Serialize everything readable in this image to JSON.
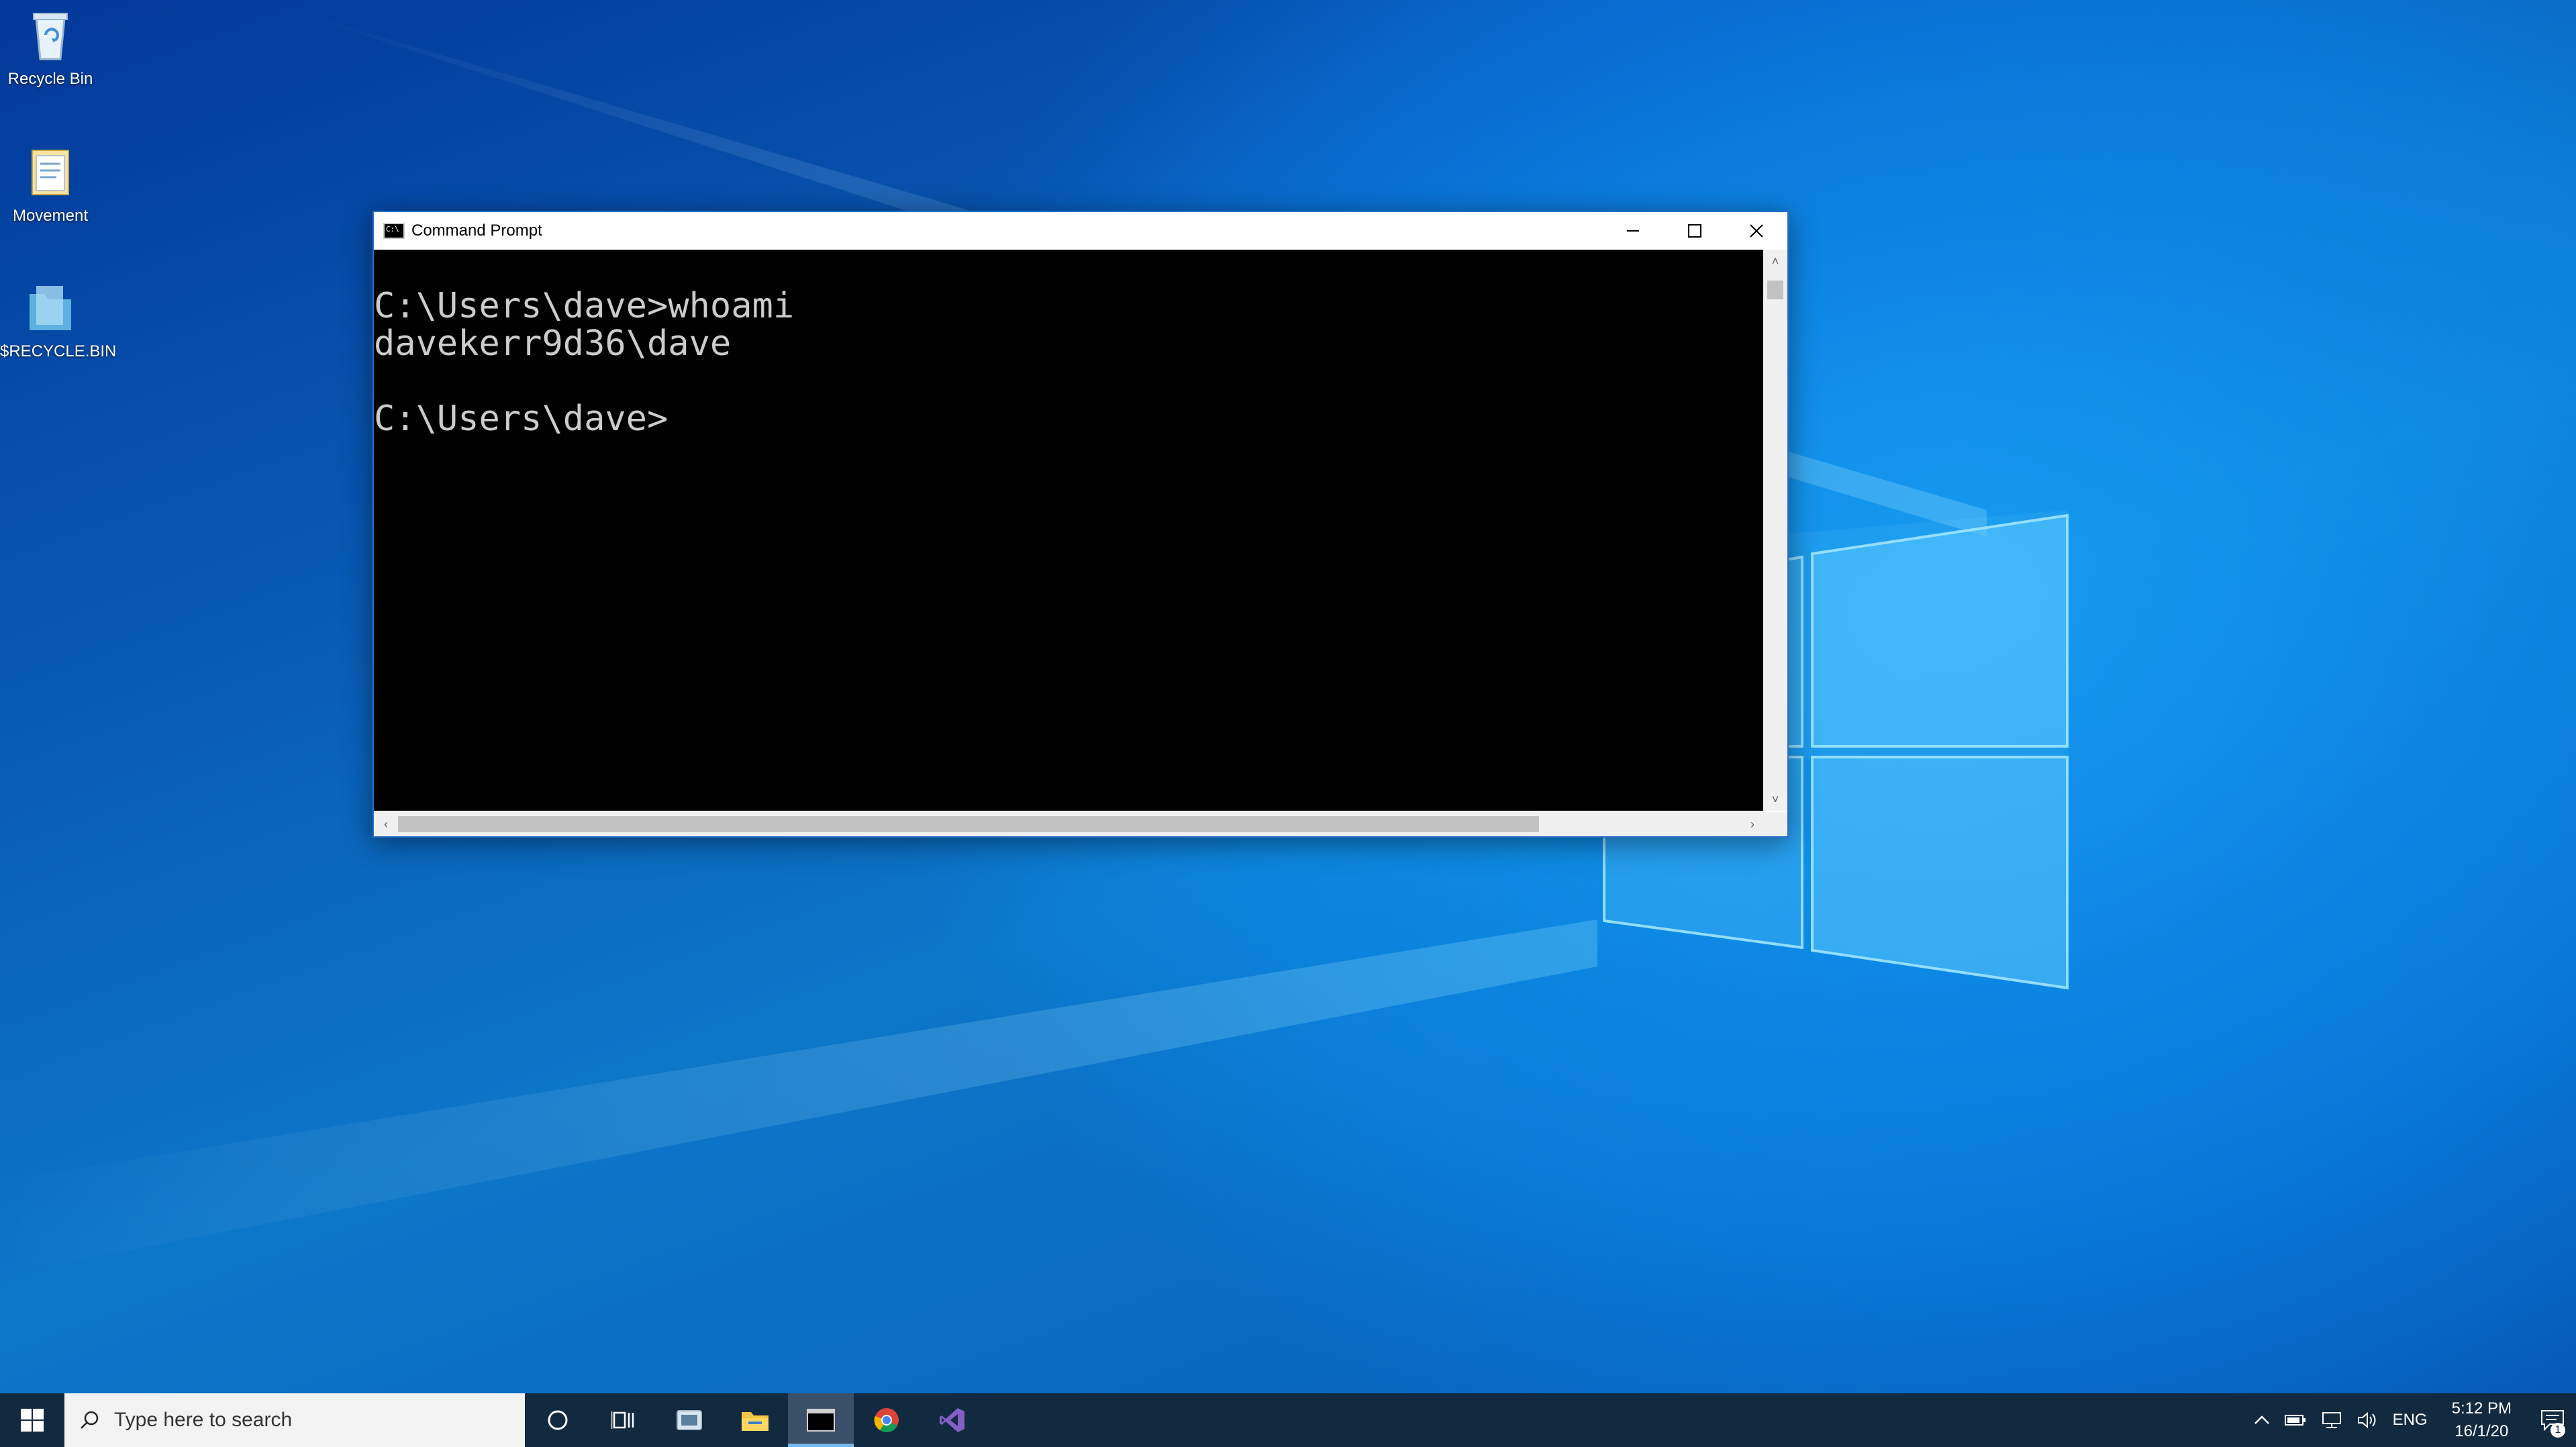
{
  "desktop": {
    "icons": [
      {
        "label": "Recycle Bin",
        "icon": "recycle-bin-icon"
      },
      {
        "label": "Movement",
        "icon": "notepad-file-icon"
      },
      {
        "label": "$RECYCLE.BIN",
        "icon": "folder-icon"
      }
    ]
  },
  "window": {
    "title": "Command Prompt",
    "icon": "cmd-icon",
    "controls": {
      "minimize": "minimize-icon",
      "maximize": "maximize-icon",
      "close": "close-icon"
    },
    "console_lines": [
      "",
      "C:\\Users\\dave>whoami",
      "davekerr9d36\\dave",
      "",
      "C:\\Users\\dave>"
    ],
    "background": "#000000",
    "foreground": "#cccccc"
  },
  "taskbar": {
    "search_placeholder": "Type here to search",
    "apps": [
      "cortana-icon",
      "task-view-icon",
      "file-browser-icon",
      "file-explorer-icon",
      "command-prompt-icon",
      "chrome-icon",
      "visual-studio-icon"
    ],
    "active_app": "command-prompt-icon",
    "tray": {
      "language": "ENG",
      "time": "5:12 PM",
      "date": "16/1/20",
      "notification_count": "1"
    },
    "background": "#122a40",
    "accent": "#76b9ed"
  }
}
